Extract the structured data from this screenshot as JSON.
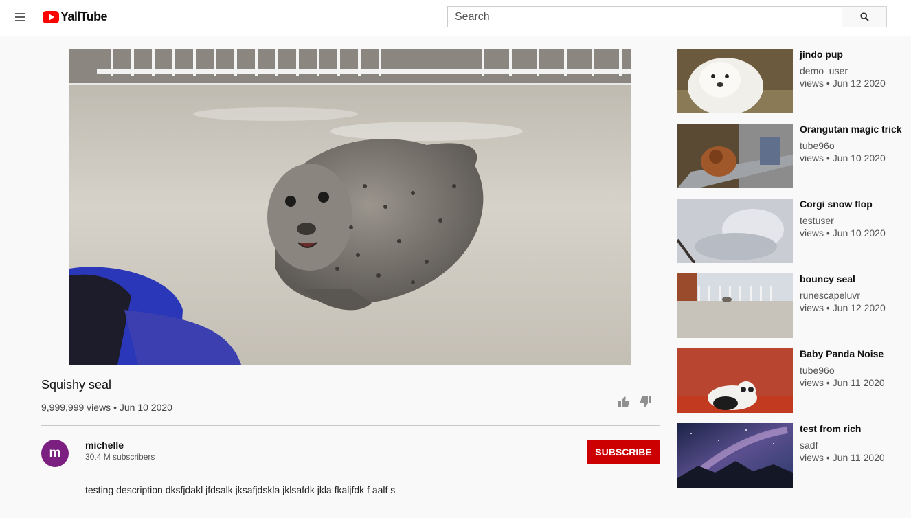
{
  "header": {
    "logo_text": "YallTube",
    "search_placeholder": "Search"
  },
  "video": {
    "title": "Squishy seal",
    "views": "9,999,999 views",
    "separator": "•",
    "date": "Jun 10 2020",
    "meta": "9,999,999 views • Jun 10 2020"
  },
  "channel": {
    "avatar_letter": "m",
    "name": "michelle",
    "subscribers": "30.4 M subscribers",
    "subscribe_label": "SUBSCRIBE"
  },
  "description": "testing description dksfjdakl jfdsalk jksafjdskla jklsafdk jkla fkaljfdk f aalf s",
  "recommendations": [
    {
      "title": "jindo pup",
      "channel": "demo_user",
      "meta": "views • Jun 12 2020"
    },
    {
      "title": "Orangutan magic trick",
      "channel": "tube96o",
      "meta": "views • Jun 10 2020"
    },
    {
      "title": "Corgi snow flop",
      "channel": "testuser",
      "meta": "views • Jun 10 2020"
    },
    {
      "title": "bouncy seal",
      "channel": "runescapeluvr",
      "meta": "views • Jun 12 2020"
    },
    {
      "title": "Baby Panda Noise",
      "channel": "tube96o",
      "meta": "views • Jun 11 2020"
    },
    {
      "title": "test from rich",
      "channel": "sadf",
      "meta": "views • Jun 11 2020"
    }
  ],
  "colors": {
    "brand_red": "#ff0000",
    "subscribe_red": "#cc0000",
    "avatar_purple": "#7b1f80",
    "background": "#f9f9f9"
  },
  "icons": [
    "menu-icon",
    "play-logo-icon",
    "search-icon",
    "thumbs-up-icon",
    "thumbs-down-icon"
  ]
}
